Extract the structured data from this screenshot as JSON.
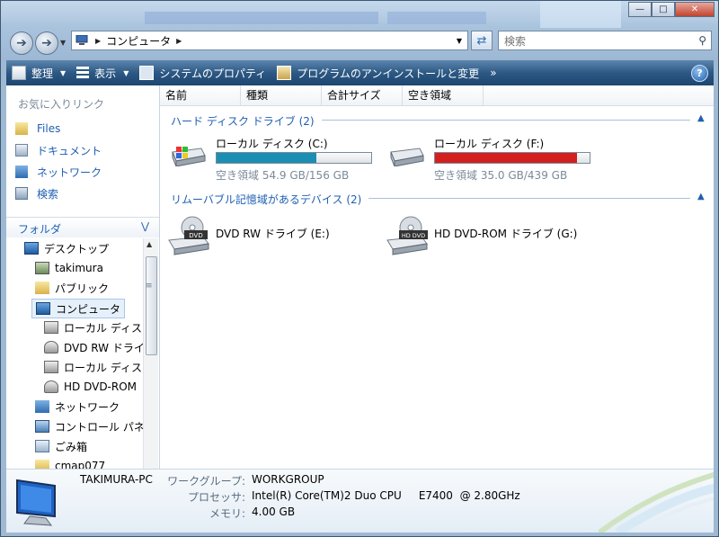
{
  "address": {
    "crumb": "コンピュータ"
  },
  "search": {
    "placeholder": "検索"
  },
  "toolbar": {
    "organize": "整理",
    "views": "表示",
    "system_properties": "システムのプロパティ",
    "uninstall": "プログラムのアンインストールと変更",
    "more": "»",
    "help": "?"
  },
  "nav": {
    "favorites_title": "お気に入りリンク",
    "favorites": [
      "Files",
      "ドキュメント",
      "ネットワーク",
      "検索"
    ],
    "folders_title": "フォルダ",
    "tree": [
      "デスクトップ",
      "takimura",
      "パブリック",
      "コンピュータ",
      "ローカル ディス",
      "DVD RW ドライ",
      "ローカル ディス",
      "HD DVD-ROM",
      "ネットワーク",
      "コントロール パネ",
      "ごみ箱",
      "cmap077"
    ]
  },
  "columns": [
    "名前",
    "種類",
    "合計サイズ",
    "空き領域"
  ],
  "groups": {
    "hdd": "ハード ディスク ドライブ (2)",
    "removable": "リムーバブル記憶域があるデバイス (2)"
  },
  "drives": [
    {
      "name": "ローカル ディスク (C:)",
      "free_text": "空き領域 54.9 GB/156 GB",
      "used_fraction": 0.648,
      "bar_color": "#1b8fb3"
    },
    {
      "name": "ローカル ディスク (F:)",
      "free_text": "空き領域 35.0 GB/439 GB",
      "used_fraction": 0.92,
      "bar_color": "#d41f1f"
    }
  ],
  "removable": [
    {
      "name": "DVD RW ドライブ (E:)",
      "badge": "DVD"
    },
    {
      "name": "HD DVD-ROM ドライブ (G:)",
      "badge": "HD DVD"
    }
  ],
  "details": {
    "pc_name": "TAKIMURA-PC",
    "workgroup_label": "ワークグループ:",
    "workgroup": "WORKGROUP",
    "processor_label": "プロセッサ:",
    "processor": "Intel(R) Core(TM)2 Duo CPU     E7400  @ 2.80GHz",
    "memory_label": "メモリ:",
    "memory": "4.00 GB"
  }
}
